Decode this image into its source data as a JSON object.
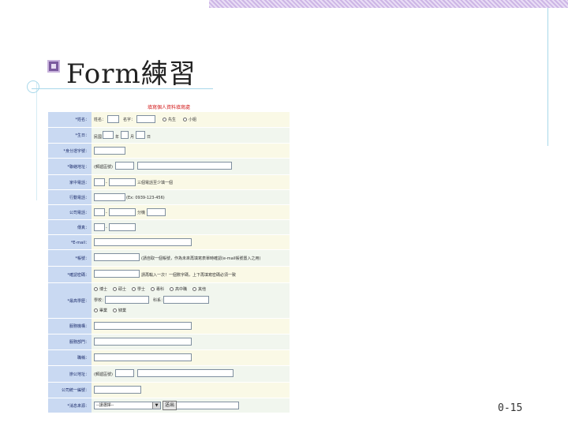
{
  "slide": {
    "title": "Form練習",
    "page_number": "0-15",
    "accent_colors": [
      "#7b5a9e",
      "#a8d8ea",
      "#cdb6e6"
    ]
  },
  "form": {
    "heading": "填寫個人資料填寫處",
    "submit_label": "送出",
    "fields": {
      "name": {
        "label": "*姓名：",
        "surname": "姓名：",
        "given": "名字：",
        "options": [
          "先生",
          "小姐"
        ]
      },
      "birthday": {
        "label": "*生日：",
        "era": "民國",
        "year": "年",
        "month": "月",
        "day": "日"
      },
      "id_number": {
        "label": "*身分證字號："
      },
      "address": {
        "label": "*聯絡地址：",
        "zip_text": "(郵遞區號)"
      },
      "home_phone": {
        "label": "家中電話：",
        "sep": "-",
        "hint": "三個電話至少填一個"
      },
      "mobile": {
        "label": "行動電話：",
        "hint": "(Ex: 0939-123-456)"
      },
      "office_phone": {
        "label": "公司電話：",
        "sep": "-",
        "ext": "分機"
      },
      "fax": {
        "label": "傳真：",
        "sep": "-"
      },
      "email": {
        "label": "*E-mail："
      },
      "account": {
        "label": "*帳號：",
        "hint": "(請自取一個帳號，作為未來再填寫表單時確認(e-mail帳號置入之用)"
      },
      "password": {
        "label": "*確認密碼：",
        "hint": "請再輸入一次！一個數字碼，上下再填寫密碼必須一致"
      },
      "education": {
        "label": "*最高學歷：",
        "options": [
          "博士",
          "碩士",
          "學士",
          "專科",
          "高中職",
          "其他"
        ],
        "school": "學校：",
        "dept": "科系：",
        "status": [
          "畢業",
          "肄業"
        ]
      },
      "occupation": {
        "label": "服務機構："
      },
      "department": {
        "label": "服務部門："
      },
      "job_title": {
        "label": "職稱："
      },
      "office_address": {
        "label": "辦公地址：",
        "zip_text": "(郵遞區號)"
      },
      "tax_id": {
        "label": "公司統一編號："
      },
      "source": {
        "label": "*消息來源：",
        "select_value": "--請選擇--"
      }
    }
  }
}
